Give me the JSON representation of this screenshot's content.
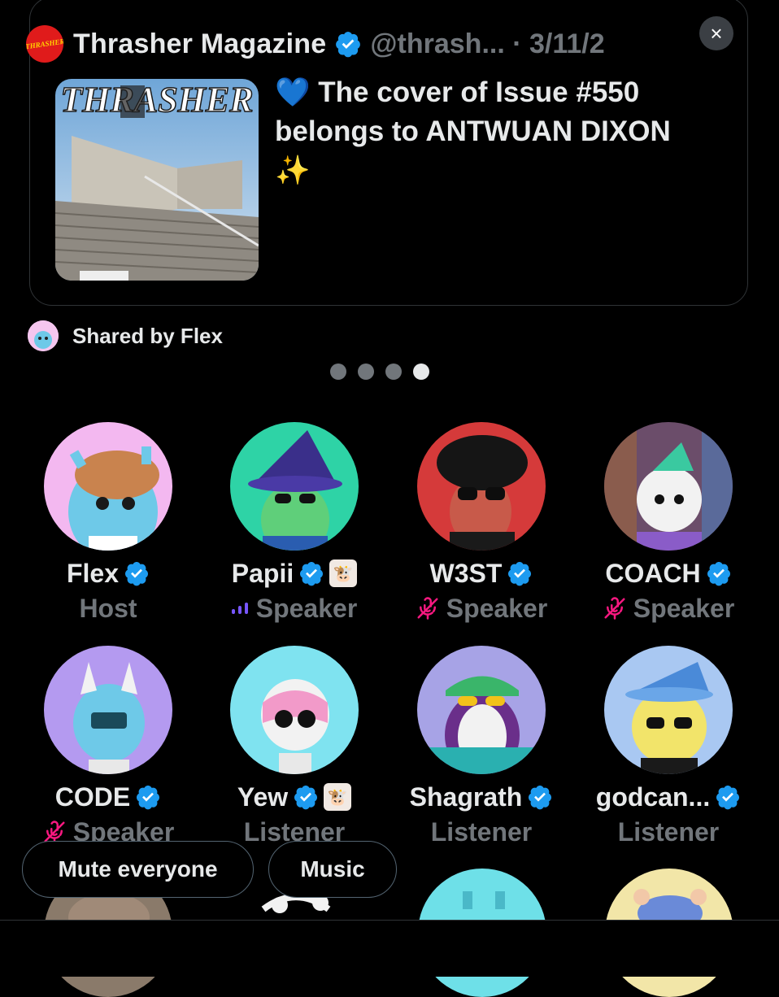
{
  "post": {
    "author": "Thrasher Magazine",
    "handle_date": "@thrash... · 3/11/2",
    "logo_text": "THRASHER",
    "text_line1": "💙 The cover of Issue #550",
    "text_line2": "belongs to ANTWUAN DIXON",
    "text_line3": "✨",
    "thumbnail_title": "THRASHER",
    "close_icon": "×"
  },
  "shared": {
    "label": "Shared by Flex"
  },
  "carousel": {
    "count": 4,
    "active": 4
  },
  "participants": [
    {
      "name": "Flex",
      "role": "Host",
      "verified": true,
      "color": "#f3b8f0"
    },
    {
      "name": "Papii",
      "role": "Speaker",
      "verified": true,
      "color": "#2ed3a6"
    },
    {
      "name": "W3ST",
      "role": "Speaker",
      "verified": true,
      "color": "#d53a3a"
    },
    {
      "name": "COACH",
      "role": "Speaker",
      "verified": true,
      "color": "#6b4d6a"
    },
    {
      "name": "CODE",
      "role": "Speaker",
      "verified": true,
      "color": "#b49af0"
    },
    {
      "name": "Yew",
      "role": "Listener",
      "verified": true,
      "color": "#7fe3f0"
    },
    {
      "name": "Shagrath",
      "role": "Listener",
      "verified": true,
      "color": "#a7a3e6"
    },
    {
      "name": "godcan...",
      "role": "Listener",
      "verified": true,
      "color": "#a9c8f2"
    }
  ],
  "actions": {
    "mute_everyone": "Mute everyone",
    "music": "Music"
  },
  "colors": {
    "verified": "#1d9bf0",
    "muted": "#f91880",
    "speaking": "#7856ff",
    "secondary": "#71767b"
  }
}
